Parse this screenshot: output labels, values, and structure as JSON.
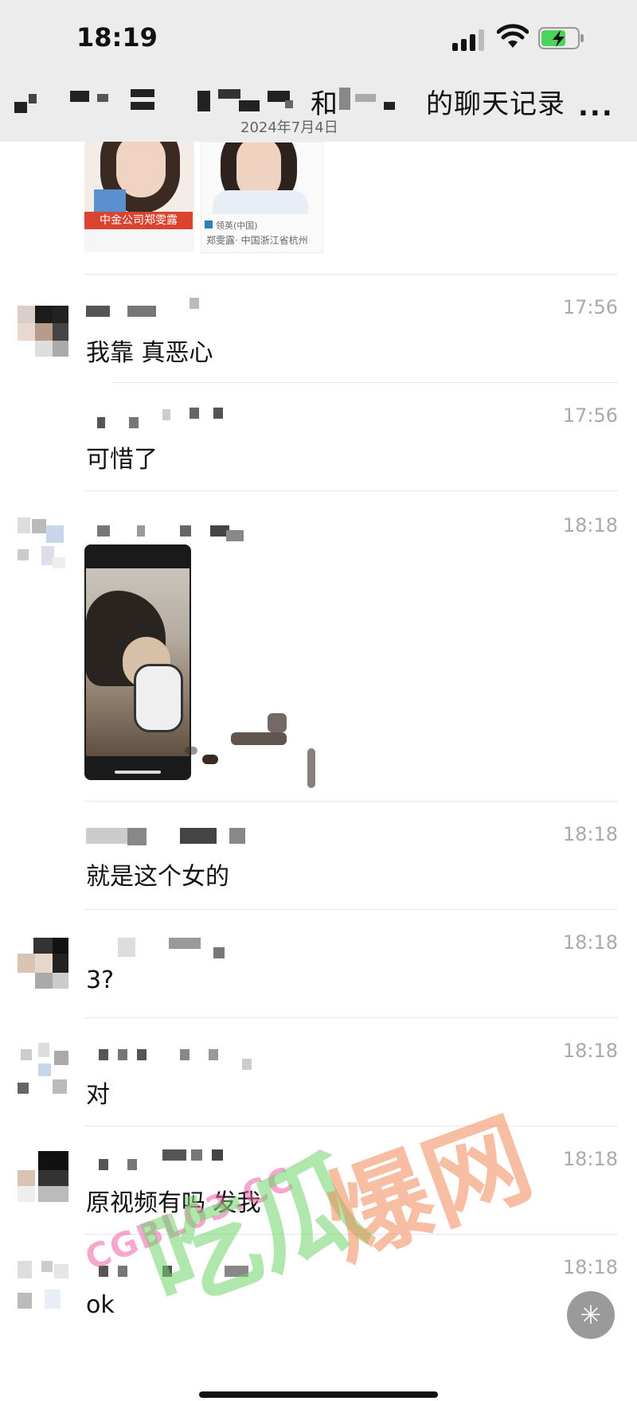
{
  "status_bar": {
    "time": "18:19"
  },
  "header": {
    "title": "和    的聊天记录",
    "title_visible": "和",
    "title_suffix": "的聊天记录",
    "date": "2024年7月4日",
    "more": "..."
  },
  "shared_images": {
    "caption_red": "中金公司郑雯露",
    "caption_small_1": "领英(中国)",
    "caption_small_2": "郑雯露· 中国浙江省杭州"
  },
  "messages": [
    {
      "time": "17:56",
      "text": "我靠 真恶心"
    },
    {
      "time": "17:56",
      "text": "可惜了"
    },
    {
      "time": "18:18",
      "text": ""
    },
    {
      "time": "18:18",
      "text": "就是这个女的"
    },
    {
      "time": "18:18",
      "text": "3?"
    },
    {
      "time": "18:18",
      "text": "对"
    },
    {
      "time": "18:18",
      "text": "原视频有吗 发我"
    },
    {
      "time": "18:18",
      "text": "ok"
    }
  ],
  "watermark": {
    "url": "CGBL03.CC",
    "left": "吃瓜",
    "right": "爆网"
  },
  "fab_icon": "sparkle-icon"
}
